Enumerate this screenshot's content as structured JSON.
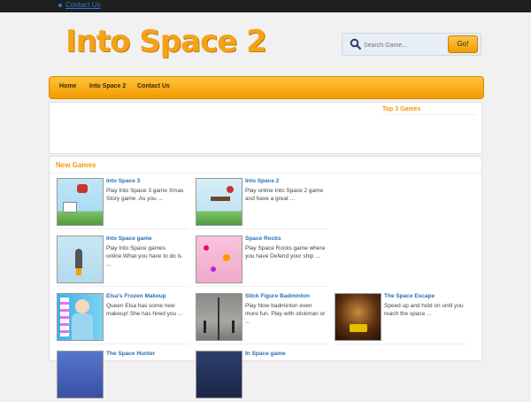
{
  "topbar": {
    "link": "Contact Us"
  },
  "logo": "Into Space 2",
  "search": {
    "placeholder": "Search Game...",
    "button": "Go!"
  },
  "nav": [
    "Home",
    "Into Space 2",
    "Contact Us"
  ],
  "top3_title": "Top 3 Games",
  "new_games_title": "New Games",
  "games": [
    {
      "title": "Into Space 3",
      "desc": "Play Into Space 3 game Xmas Story game .As you ..."
    },
    {
      "title": "Into Space 2",
      "desc": "Play online Into Space 2 game and have a great ..."
    },
    {
      "title": "Into Space game",
      "desc": "Play Into Space games online.What you have to do is ..."
    },
    {
      "title": "Space Rocks",
      "desc": "Play Space Rocks game where you have Defend your ship ..."
    },
    {
      "title": "Elsa's Frozen Makeup",
      "desc": "Queen Elsa has some new makeup! She has hired you ..."
    },
    {
      "title": "Stick Figure Badminton",
      "desc": "Play Now badminton even more fun. Play with stickman or ..."
    },
    {
      "title": "The Space Escape",
      "desc": "Speed up and hold on until you reach the space ..."
    },
    {
      "title": "The Space Hunter",
      "desc": ""
    },
    {
      "title": "In Space game",
      "desc": ""
    }
  ]
}
